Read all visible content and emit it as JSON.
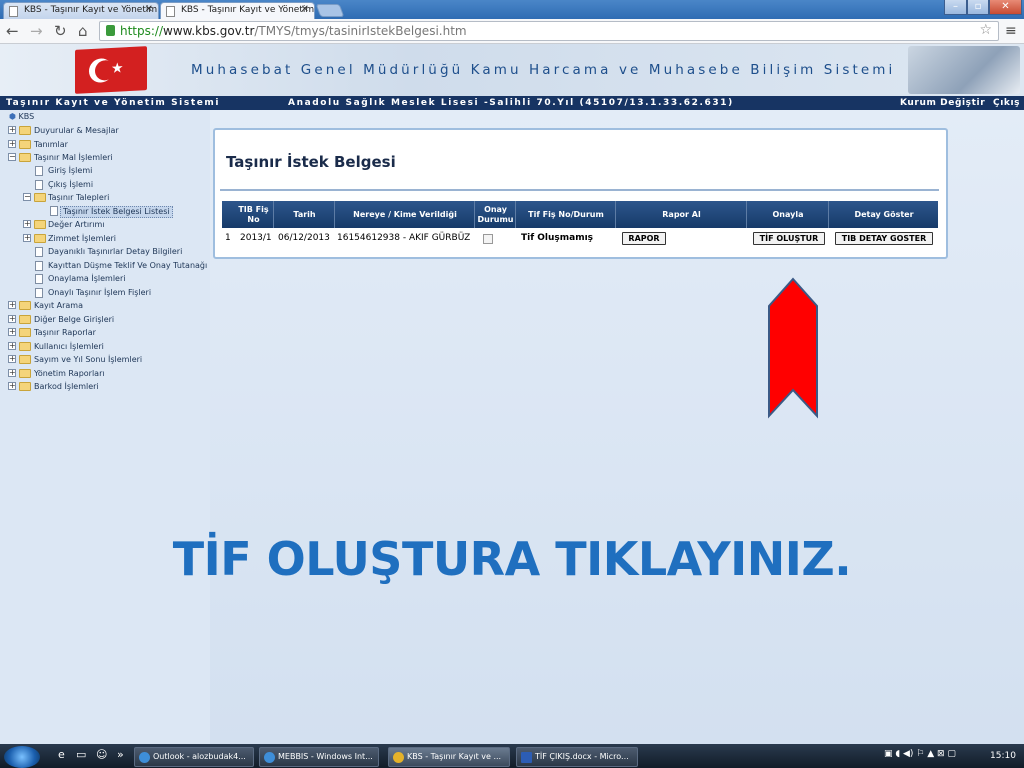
{
  "browser": {
    "tabs": [
      {
        "title": "KBS - Taşınır Kayıt ve Yönetim Sistemi",
        "active": false
      },
      {
        "title": "KBS - Taşınır Kayıt ve Yönetim Sistemi",
        "active": true
      }
    ],
    "url_scheme": "https://",
    "url_host": "www.kbs.gov.tr",
    "url_path": "/TMYS/tmys/tasinirIstekBelgesi.htm"
  },
  "banner": {
    "title": "Muhasebat Genel Müdürlüğü Kamu Harcama ve Muhasebe Bilişim Sistemi"
  },
  "appbar": {
    "system": "Taşınır Kayıt ve Yönetim Sistemi",
    "institution": "Anadolu Sağlık Meslek Lisesi -Salihli 70.Yıl (45107/13.1.33.62.631)",
    "change_org": "Kurum Değiştir",
    "logout": "Çıkış"
  },
  "tree": {
    "root": "KBS",
    "items": [
      {
        "label": "Duyurular & Mesajlar"
      },
      {
        "label": "Tanımlar"
      },
      {
        "label": "Taşınır Mal İşlemleri"
      },
      {
        "label": "Giriş İşlemi"
      },
      {
        "label": "Çıkış İşlemi"
      },
      {
        "label": "Taşınır Talepleri"
      },
      {
        "label": "Taşınır İstek Belgesi Listesi"
      },
      {
        "label": "Değer Artırımı"
      },
      {
        "label": "Zimmet İşlemleri"
      },
      {
        "label": "Dayanıklı Taşınırlar Detay Bilgileri"
      },
      {
        "label": "Kayıttan Düşme Teklif Ve Onay Tutanağı"
      },
      {
        "label": "Onaylama İşlemleri"
      },
      {
        "label": "Onaylı Taşınır İşlem Fişleri"
      },
      {
        "label": "Kayıt Arama"
      },
      {
        "label": "Diğer Belge Girişleri"
      },
      {
        "label": "Taşınır Raporlar"
      },
      {
        "label": "Kullanıcı İşlemleri"
      },
      {
        "label": "Sayım ve Yıl Sonu İşlemleri"
      },
      {
        "label": "Yönetim Raporları"
      },
      {
        "label": "Barkod İşlemleri"
      }
    ]
  },
  "page": {
    "title": "Taşınır İstek Belgesi",
    "columns": [
      "TIB Fiş No",
      "Tarih",
      "Nereye / Kime Verildiği",
      "Onay Durumu",
      "Tif Fiş No/Durum",
      "Rapor Al",
      "Onayla",
      "Detay Göster"
    ],
    "rows": [
      {
        "index": "1",
        "fis_no": "2013/1",
        "tarih": "06/12/2013",
        "nereye": "16154612938 - AKIF GÜRBÜZ",
        "tif_durum": "Tif Oluşmamış",
        "rapor_btn": "RAPOR",
        "onayla_btn": "TİF OLUŞTUR",
        "detay_btn": "TIB DETAY GOSTER"
      }
    ]
  },
  "instruction": "TİF OLUŞTURA TIKLAYINIZ.",
  "colors": {
    "accent": "#1f6fbf",
    "arrow": "#ff0000",
    "header_dark": "#173463"
  },
  "taskbar": {
    "items": [
      {
        "label": "Outlook - alozbudak4..."
      },
      {
        "label": "MEBBIS - Windows Int..."
      },
      {
        "label": "KBS - Taşınır Kayıt ve ..."
      },
      {
        "label": "TİF ÇIKIŞ.docx - Micro..."
      }
    ],
    "clock": "15:10"
  }
}
